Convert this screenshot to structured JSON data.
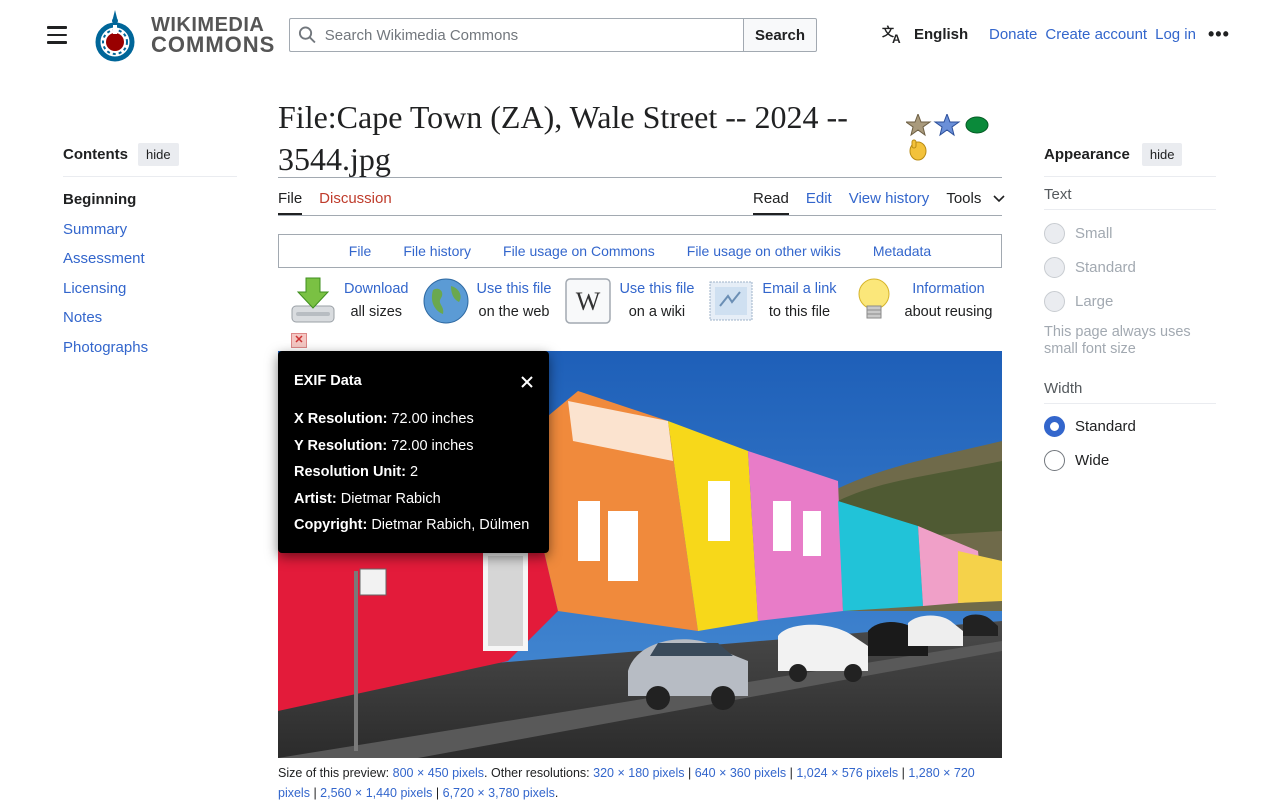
{
  "header": {
    "wordmark_line1": "WIKIMEDIA",
    "wordmark_line2": "COMMONS",
    "search_placeholder": "Search Wikimedia Commons",
    "search_button": "Search",
    "language": "English",
    "donate": "Donate",
    "create_account": "Create account",
    "log_in": "Log in",
    "more": "•••"
  },
  "toc": {
    "title": "Contents",
    "hide": "hide",
    "items": [
      "Beginning",
      "Summary",
      "Assessment",
      "Licensing",
      "Notes",
      "Photographs"
    ]
  },
  "page": {
    "title": "File:Cape Town (ZA), Wale Street -- 2024 -- 3544.jpg"
  },
  "tabs": {
    "file": "File",
    "discussion": "Discussion",
    "read": "Read",
    "edit": "Edit",
    "view_history": "View history",
    "tools": "Tools"
  },
  "filenav": [
    "File",
    "File history",
    "File usage on Commons",
    "File usage on other wikis",
    "Metadata"
  ],
  "actions": [
    {
      "line1": "Download",
      "line2": "all sizes",
      "icon": "download-icon"
    },
    {
      "line1": "Use this file",
      "line2": "on the web",
      "icon": "globe-icon"
    },
    {
      "line1": "Use this file",
      "line2": "on a wiki",
      "icon": "wikipedia-icon"
    },
    {
      "line1": "Email a link",
      "line2": "to this file",
      "icon": "email-icon"
    },
    {
      "line1": "Information",
      "line2": "about reusing",
      "icon": "lightbulb-icon"
    }
  ],
  "exif": {
    "title": "EXIF Data",
    "rows": [
      {
        "label": "X Resolution:",
        "value": "72.00 inches"
      },
      {
        "label": "Y Resolution:",
        "value": "72.00 inches"
      },
      {
        "label": "Resolution Unit:",
        "value": "2"
      },
      {
        "label": "Artist:",
        "value": "Dietmar Rabich"
      },
      {
        "label": "Copyright:",
        "value": "Dietmar Rabich, Dülmen"
      }
    ]
  },
  "preview": {
    "label": "Size of this preview:",
    "current": "800 × 450 pixels",
    "other_label": ". Other resolutions:",
    "others": [
      "320 × 180 pixels",
      "640 × 360 pixels",
      "1,024 × 576 pixels",
      "1,280 × 720 pixels",
      "2,560 × 1,440 pixels",
      "6,720 × 3,780 pixels"
    ]
  },
  "appearance": {
    "title": "Appearance",
    "hide": "hide",
    "text_label": "Text",
    "text_options": [
      "Small",
      "Standard",
      "Large"
    ],
    "text_note": "This page always uses small font size",
    "width_label": "Width",
    "width_options": [
      "Standard",
      "Wide"
    ],
    "width_selected": "Standard"
  },
  "colors": {
    "link": "#3366cc",
    "discussion_red": "#bf3c2c",
    "exif_bg": "#000000"
  }
}
